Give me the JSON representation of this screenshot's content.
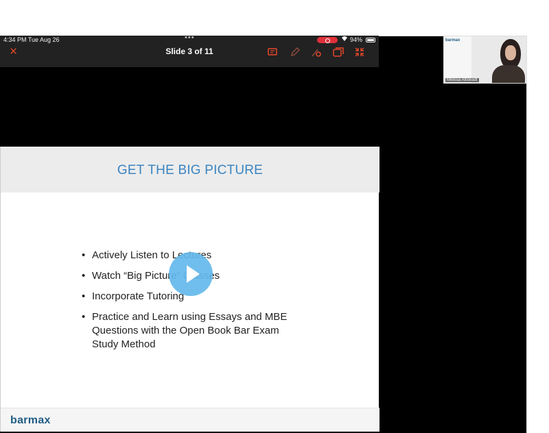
{
  "status_bar": {
    "time": "4:34 PM  Tue Aug 26",
    "dots": "•••",
    "battery": "94%"
  },
  "toolbar": {
    "close_icon": "×",
    "title": "Slide 3 of 11"
  },
  "slide": {
    "title": "GET THE BIG PICTURE",
    "bullets": [
      "Actively Listen to Lectures",
      "Watch “Big Picture” Classes",
      "Incorporate Tutoring",
      "Practice and Learn using Essays and MBE Questions with the Open Book Bar Exam Study Method"
    ],
    "footer_logo": "barmax"
  },
  "video": {
    "play_icon": "play-icon"
  },
  "participant": {
    "name": "Melissa Allsteadt",
    "logo": "barmax"
  }
}
